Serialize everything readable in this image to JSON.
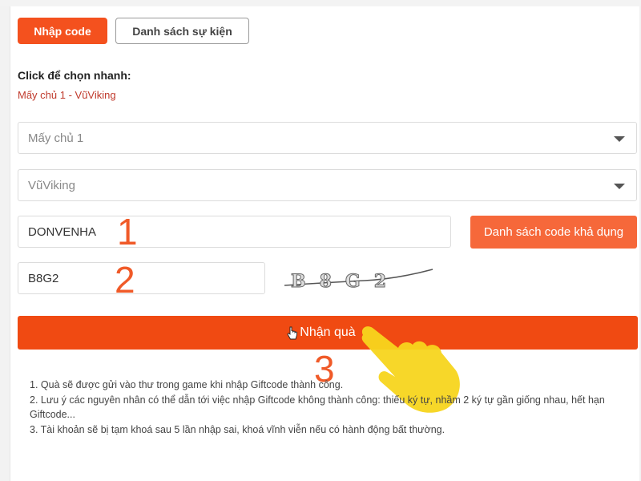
{
  "tabs": {
    "enter_code": "Nhập code",
    "event_list": "Danh sách sự kiện"
  },
  "quick_select": {
    "title": "Click để chọn nhanh:",
    "link": "Mấy chủ 1 - VũViking"
  },
  "server_select": {
    "value": "Mấy chủ 1"
  },
  "character_select": {
    "value": "VũViking"
  },
  "code_input": {
    "value": "DONVENHA"
  },
  "codes_button": {
    "label": "Danh sách code khả dụng"
  },
  "captcha_input": {
    "value": "B8G2"
  },
  "captcha_image": {
    "text": "B8G2"
  },
  "submit_button": {
    "label": "Nhận quà"
  },
  "annotations": {
    "step1": "1",
    "step2": "2",
    "step3": "3"
  },
  "notes": [
    "1. Quà sẽ được gửi vào thư trong game khi nhập Giftcode thành công.",
    "2. Lưu ý các nguyên nhân có thể dẫn tới việc nhập Giftcode không thành công: thiếu ký tự, nhầm 2 ký tự gần giống nhau, hết hạn Giftcode...",
    "3. Tài khoản sẽ bị tạm khoá sau 5 lần nhập sai, khoá vĩnh viễn nếu có hành động bất thường."
  ],
  "colors": {
    "accent": "#f4511e",
    "submit": "#f04a12",
    "link": "#c0392b",
    "annotation": "#f05a28",
    "hand": "#f7d51d"
  },
  "icons": {
    "caret": "chevron-down-icon",
    "cursor": "pointer-cursor-icon",
    "hand": "pointing-hand-icon"
  }
}
